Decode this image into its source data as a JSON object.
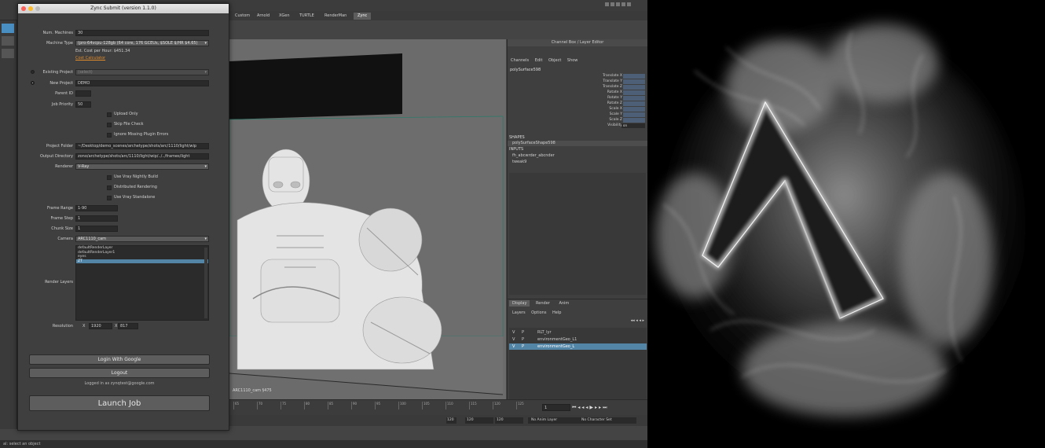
{
  "dialog": {
    "title": "Zync Submit (version 1.1.0)",
    "num_machines_label": "Num. Machines",
    "num_machines_value": "30",
    "machine_type_label": "Machine Type",
    "machine_type_value": "(pro-64vcpu-128gb (64 core, 176 GCEUs, $SOLE $/HR $4.65)",
    "est_cost_text": "Est. Cost per Hour: $451.34",
    "cost_calculator_link": "Cost Calculator",
    "existing_project_label": "Existing Project",
    "existing_project_value": "(select)",
    "new_project_label": "New Project",
    "new_project_value": "DEMO",
    "parent_id_label": "Parent ID",
    "parent_id_value": "",
    "job_priority_label": "Job Priority",
    "job_priority_value": "50",
    "upload_only_label": "Upload Only",
    "skip_file_check_label": "Skip File Check",
    "ignore_plugin_errors_label": "Ignore Missing Plugin Errors",
    "project_folder_label": "Project Folder",
    "project_folder_value": "~/Desktop/demo_scenes/archetype/shots/arc/1110/light/wip",
    "output_directory_label": "Output Directory",
    "output_directory_value": "zono/archetype/shots/arc/1110/light/wip/../../frames/light",
    "renderer_label": "Renderer",
    "renderer_value": "V-Ray",
    "use_vray_nightly_label": "Use Vray Nightly Build",
    "distributed_rendering_label": "Distributed Rendering",
    "use_vray_standalone_label": "Use Vray Standalone",
    "frame_range_label": "Frame Range",
    "frame_range_value": "1-90",
    "frame_step_label": "Frame Step",
    "frame_step_value": "1",
    "chunk_size_label": "Chunk Size",
    "chunk_size_value": "1",
    "camera_label": "Camera",
    "camera_value": "ARC1110_cam",
    "render_layers_label": "Render Layers",
    "render_layers": [
      "defaultRenderLayer",
      "defaultRenderLayer1",
      "eyes",
      "ZT"
    ],
    "resolution_label": "Resolution",
    "res_x_label": "X",
    "res_x_value": "1920",
    "res_y_label": "X",
    "res_y_value": "817",
    "login_google_label": "Login With Google",
    "logout_label": "Logout",
    "logged_in_text": "Logged in as zynqtest@google.com",
    "launch_label": "Launch Job"
  },
  "shelf": {
    "tabs": [
      "Custom",
      "Arnold",
      "XGen",
      "TURTLE",
      "RenderMan",
      "Zync"
    ],
    "active": "Zync"
  },
  "viewport": {
    "camera_label": "ARC1110_cam  §475"
  },
  "channel_box": {
    "header": "Channel Box / Layer Editor",
    "menu": [
      "Channels",
      "Edit",
      "Object",
      "Show"
    ],
    "object_name": "polySurface598",
    "attributes": [
      "Translate X",
      "Translate Y",
      "Translate Z",
      "Rotate X",
      "Rotate Y",
      "Rotate Z",
      "Scale X",
      "Scale Y",
      "Scale Z",
      "Visibility"
    ],
    "visibility_value": "on",
    "shapes_header": "SHAPES",
    "shape_item": "polySurfaceShape598",
    "inputs_header": "INPUTS",
    "input_items": [
      "fh_abcwrder_abcnder",
      "tweak9"
    ]
  },
  "layer_editor": {
    "tabs": [
      "Display",
      "Render",
      "Anim"
    ],
    "active_tab": "Display",
    "menu": [
      "Layers",
      "Options",
      "Help"
    ],
    "layers": [
      {
        "v": "V",
        "p": "P",
        "name": "RLT_lyr"
      },
      {
        "v": "V",
        "p": "P",
        "name": "environmentGeo_L1"
      },
      {
        "v": "V",
        "p": "P",
        "name": "environmentGeo_L"
      }
    ]
  },
  "timeline": {
    "ticks": [
      "65",
      "70",
      "75",
      "80",
      "85",
      "90",
      "95",
      "100",
      "105",
      "110",
      "115",
      "120",
      "125"
    ],
    "current_frame": "1",
    "range_start": "120",
    "range_mid": "120",
    "range_end": "120",
    "anim_layer": "No Anim Layer",
    "character_set": "No Character Set"
  },
  "status_bar": {
    "text": "al: select an object"
  },
  "colors": {
    "accent": "#5285a6",
    "link": "#e08b2c",
    "dialog_bg": "#3f3f3f"
  }
}
